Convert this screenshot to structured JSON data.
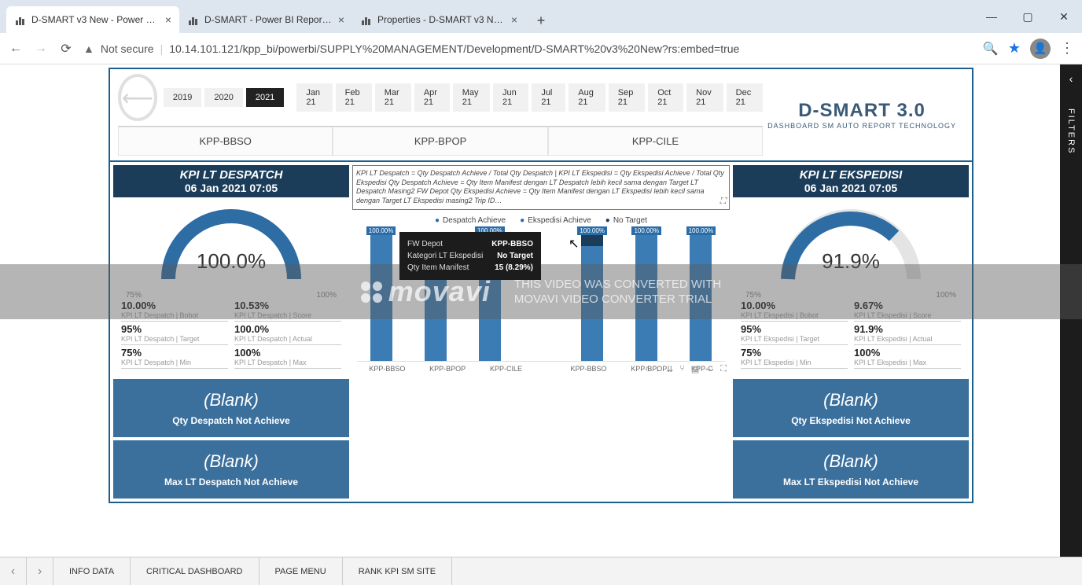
{
  "browser": {
    "tabs": [
      {
        "title": "D-SMART v3 New - Power BI Rep"
      },
      {
        "title": "D-SMART - Power BI Report Ser"
      },
      {
        "title": "Properties - D-SMART v3 New -"
      }
    ],
    "url_notsecure": "Not secure",
    "url": "10.14.101.121/kpp_bi/powerbi/SUPPLY%20MANAGEMENT/Development/D-SMART%20v3%20New?rs:embed=true"
  },
  "filters_label": "FILTERS",
  "header": {
    "years": [
      "2019",
      "2020",
      "2021"
    ],
    "year_selected": "2021",
    "months": [
      "Jan 21",
      "Feb 21",
      "Mar 21",
      "Apr 21",
      "May 21",
      "Jun 21",
      "Jul 21",
      "Aug 21",
      "Sep 21",
      "Oct 21",
      "Nov 21",
      "Dec 21"
    ],
    "sites": [
      "KPP-BBSO",
      "KPP-BPOP",
      "KPP-CILE"
    ],
    "brand": "D-SMART 3.0",
    "brand_sub": "DASHBOARD SM AUTO REPORT TECHNOLOGY"
  },
  "left": {
    "title": "KPI LT DESPATCH",
    "date": "06 Jan 2021 07:05",
    "gauge_value": "100.0%",
    "gauge_min": "75%",
    "gauge_max": "100%",
    "kpis": [
      {
        "v": "10.00%",
        "l": "KPI LT Despatch | Bobot"
      },
      {
        "v": "10.53%",
        "l": "KPI LT Despatch | Score"
      },
      {
        "v": "95%",
        "l": "KPI LT Despatch | Target"
      },
      {
        "v": "100.0%",
        "l": "KPI LT Despatch | Actual"
      },
      {
        "v": "75%",
        "l": "KPI LT Despatch | Min"
      },
      {
        "v": "100%",
        "l": "KPI LT Despatch | Max"
      }
    ],
    "card1": {
      "bl": "(Blank)",
      "tx": "Qty Despatch Not Achieve"
    },
    "card2": {
      "bl": "(Blank)",
      "tx": "Max LT Despatch Not Achieve"
    }
  },
  "right": {
    "title": "KPI LT EKSPEDISI",
    "date": "06 Jan 2021 07:05",
    "gauge_value": "91.9%",
    "gauge_min": "75%",
    "gauge_max": "100%",
    "kpis": [
      {
        "v": "10.00%",
        "l": "KPI LT Ekspedisi | Bobot"
      },
      {
        "v": "9.67%",
        "l": "KPI LT Ekspedisi | Score"
      },
      {
        "v": "95%",
        "l": "KPI LT Ekspedisi | Target"
      },
      {
        "v": "91.9%",
        "l": "KPI LT Ekspedisi | Actual"
      },
      {
        "v": "75%",
        "l": "KPI LT Ekspedisi | Min"
      },
      {
        "v": "100%",
        "l": "KPI LT Ekspedisi | Max"
      }
    ],
    "card1": {
      "bl": "(Blank)",
      "tx": "Qty Ekspedisi Not Achieve"
    },
    "card2": {
      "bl": "(Blank)",
      "tx": "Max LT Ekspedisi Not Achieve"
    }
  },
  "desc": "KPI LT Despatch = Qty Despatch Achieve / Total Qty Despatch     |     KPI LT Ekspedisi = Qty Ekspedisi Achieve / Total Qty Ekspedisi   Qty Despatch Achieve = Qty Item Manifest dengan LT Despatch lebih kecil sama dengan Target LT Despatch Masing2 FW Depot   Qty Ekspedisi Achieve = Qty Item Manifest dengan LT Ekspedisi lebih kecil sama dengan Target LT Ekspedisi masing2 Trip ID…",
  "chart": {
    "legend": [
      "Despatch Achieve",
      "Ekspedisi Achieve",
      "No Target"
    ],
    "labels": [
      "100.00%",
      "",
      "100.00%",
      "100.00%",
      "100.00%",
      "100.00%"
    ],
    "cats": [
      "KPP-BBSO",
      "KPP-BPOP",
      "KPP-CILE",
      "KPP-BBSO",
      "KPP-BPOP",
      "KPP-C"
    ],
    "tooltip": {
      "r1k": "FW Depot",
      "r1v": "KPP-BBSO",
      "r2k": "Kategori LT Ekspedisi",
      "r2v": "No Target",
      "r3k": "Qty Item Manifest",
      "r3v": "15 (8.29%)"
    }
  },
  "chart_data": {
    "type": "bar",
    "title": "",
    "series_legend": [
      "Despatch Achieve",
      "Ekspedisi Achieve",
      "No Target"
    ],
    "groups": [
      {
        "name": "Despatch",
        "categories": [
          "KPP-BBSO",
          "KPP-BPOP",
          "KPP-CILE"
        ],
        "achieve_pct": [
          100,
          100,
          100
        ],
        "no_target_pct": [
          0,
          0,
          0
        ]
      },
      {
        "name": "Ekspedisi",
        "categories": [
          "KPP-BBSO",
          "KPP-BPOP",
          "KPP-CILE"
        ],
        "achieve_pct": [
          91.7,
          100,
          100
        ],
        "no_target_pct": [
          8.29,
          0,
          0
        ]
      }
    ],
    "ylim": [
      0,
      100
    ],
    "ylabel": "%",
    "tooltip_sample": {
      "FW Depot": "KPP-BBSO",
      "Kategori LT Ekspedisi": "No Target",
      "Qty Item Manifest": "15 (8.29%)"
    }
  },
  "bottom_tabs": [
    "INFO DATA",
    "CRITICAL DASHBOARD",
    "PAGE MENU",
    "RANK KPI SM SITE"
  ],
  "watermark": {
    "logo": "movavi",
    "line1": "THIS VIDEO WAS CONVERTED WITH",
    "line2": "MOVAVI VIDEO CONVERTER TRIAL"
  }
}
